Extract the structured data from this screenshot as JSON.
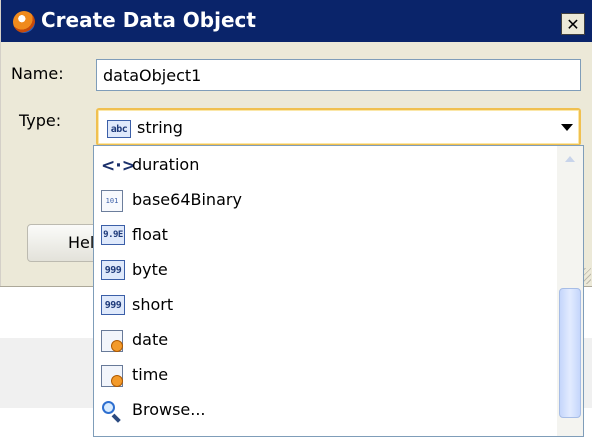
{
  "window": {
    "title": "Create Data Object",
    "close_label": "✕"
  },
  "form": {
    "name_label": "Name:",
    "name_value": "dataObject1",
    "type_label": "Type:",
    "type_value": "string",
    "type_icon_text": "abc"
  },
  "buttons": {
    "help_label": "Help"
  },
  "type_options": [
    {
      "label": "duration",
      "icon": "duration-icon",
      "icon_text": "<·>"
    },
    {
      "label": "base64Binary",
      "icon": "binary-icon",
      "icon_text": "101"
    },
    {
      "label": "float",
      "icon": "float-icon",
      "icon_text": "9.9E"
    },
    {
      "label": "byte",
      "icon": "number-icon",
      "icon_text": "999"
    },
    {
      "label": "short",
      "icon": "number-icon",
      "icon_text": "999"
    },
    {
      "label": "date",
      "icon": "calendar-icon",
      "icon_text": ""
    },
    {
      "label": "time",
      "icon": "calendar-clock-icon",
      "icon_text": ""
    },
    {
      "label": "Browse...",
      "icon": "search-icon",
      "icon_text": ""
    }
  ],
  "colors": {
    "titlebar": "#0a246a",
    "dialog_bg": "#ece9d8",
    "focus_border": "#f0c050"
  }
}
